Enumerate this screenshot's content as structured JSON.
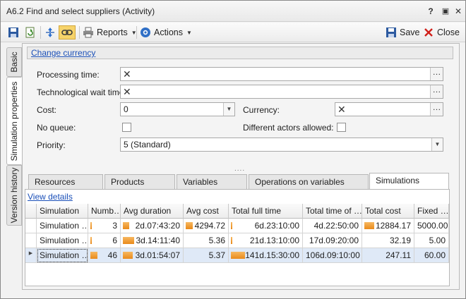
{
  "window": {
    "title": "A6.2 Find and select suppliers (Activity)",
    "help_glyph": "?",
    "restore_glyph": "▣",
    "close_glyph": "✕"
  },
  "toolbar": {
    "reports_label": "Reports",
    "actions_label": "Actions",
    "save_label": "Save",
    "close_label": "Close"
  },
  "side_tabs": [
    "Basic",
    "Simulation properties",
    "Version history"
  ],
  "currency_link": "Change currency",
  "form": {
    "processing_time_label": "Processing time:",
    "tech_wait_label": "Technological wait time:",
    "cost_label": "Cost:",
    "cost_value": "0",
    "currency_label": "Currency:",
    "no_queue_label": "No queue:",
    "diff_actors_label": "Different actors allowed:",
    "priority_label": "Priority:",
    "priority_value": "5 (Standard)"
  },
  "splitter": "....",
  "tabs": [
    "Resources",
    "Products",
    "Variables",
    "Operations on variables",
    "Simulations"
  ],
  "active_tab": "Simulations",
  "view_details": "View details",
  "grid": {
    "columns": [
      "Simulation",
      "Numb…",
      "Avg duration",
      "Avg cost",
      "Total full time",
      "Total time of …",
      "Total cost",
      "Fixed …"
    ],
    "rows": [
      {
        "simulation": "Simulation …",
        "number": "3",
        "avg_duration": "2d.07:43:20",
        "avg_cost": "4294.72",
        "total_full_time": "6d.23:10:00",
        "total_time_of": "4d.22:50:00",
        "total_cost": "12884.17",
        "fixed": "5000.00",
        "levels": {
          "number": 0.02,
          "avg_duration": 0.55,
          "avg_cost": 1.0,
          "total_full_time": 0.02,
          "total_time_of": 0.0,
          "total_cost": 1.0,
          "fixed": 0.0
        }
      },
      {
        "simulation": "Simulation …",
        "number": "6",
        "avg_duration": "3d.14:11:40",
        "avg_cost": "5.36",
        "total_full_time": "21d.13:10:00",
        "total_time_of": "17d.09:20:00",
        "total_cost": "32.19",
        "fixed": "5.00",
        "levels": {
          "number": 0.04,
          "avg_duration": 1.0,
          "avg_cost": 0.0,
          "total_full_time": 0.05,
          "total_time_of": 0.0,
          "total_cost": 0.0,
          "fixed": 0.0
        }
      },
      {
        "simulation": "Simulation …",
        "number": "46",
        "avg_duration": "3d.01:54:07",
        "avg_cost": "5.37",
        "total_full_time": "141d.15:30:00",
        "total_time_of": "106d.09:10:00",
        "total_cost": "247.11",
        "fixed": "60.00",
        "levels": {
          "number": 1.0,
          "avg_duration": 0.9,
          "avg_cost": 0.0,
          "total_full_time": 1.0,
          "total_time_of": 0.0,
          "total_cost": 0.0,
          "fixed": 0.0
        }
      }
    ],
    "selected_row": 2
  },
  "colors": {
    "accent_link": "#1a4fb8",
    "bar_orange": "#e98a1a",
    "selected_row": "#dfe9f7"
  }
}
